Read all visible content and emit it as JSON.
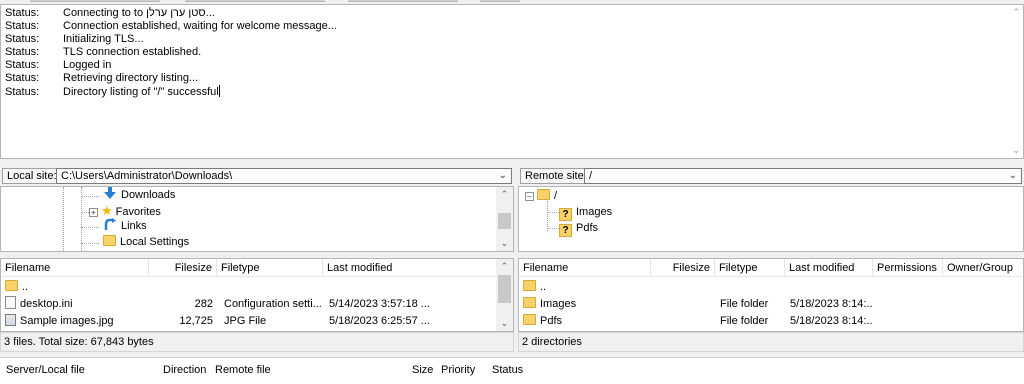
{
  "log": {
    "entries": [
      {
        "label": "Status:",
        "text": "Connecting to  to סטן ערן ערלן..."
      },
      {
        "label": "Status:",
        "text": "Connection established, waiting for welcome message..."
      },
      {
        "label": "Status:",
        "text": "Initializing TLS..."
      },
      {
        "label": "Status:",
        "text": "TLS connection established."
      },
      {
        "label": "Status:",
        "text": "Logged in"
      },
      {
        "label": "Status:",
        "text": "Retrieving directory listing..."
      },
      {
        "label": "Status:",
        "text": "Directory listing of \"/\" successful"
      }
    ]
  },
  "local": {
    "site_label": "Local site:",
    "path": "C:\\Users\\Administrator\\Downloads\\",
    "tree": [
      {
        "name": "Downloads",
        "icon": "download-arrow-icon"
      },
      {
        "name": "Favorites",
        "icon": "star-icon"
      },
      {
        "name": "Links",
        "icon": "link-arrow-icon"
      },
      {
        "name": "Local Settings",
        "icon": "folder-icon"
      }
    ],
    "columns": [
      "Filename",
      "Filesize",
      "Filetype",
      "Last modified"
    ],
    "files": [
      {
        "name": "..",
        "size": "",
        "type": "",
        "modified": "",
        "icon": "folder-icon"
      },
      {
        "name": "desktop.ini",
        "size": "282",
        "type": "Configuration setti...",
        "modified": "5/14/2023 3:57:18 ...",
        "icon": "settings-file-icon"
      },
      {
        "name": "Sample images.jpg",
        "size": "12,725",
        "type": "JPG File",
        "modified": "5/18/2023 6:25:57 ...",
        "icon": "image-file-icon"
      }
    ],
    "status": "3 files. Total size: 67,843 bytes"
  },
  "remote": {
    "site_label": "Remote site:",
    "path": "/",
    "tree": [
      {
        "name": "/",
        "icon": "folder-icon"
      },
      {
        "name": "Images",
        "icon": "unknown-folder-icon"
      },
      {
        "name": "Pdfs",
        "icon": "unknown-folder-icon"
      }
    ],
    "columns": [
      "Filename",
      "Filesize",
      "Filetype",
      "Last modified",
      "Permissions",
      "Owner/Group"
    ],
    "files": [
      {
        "name": "..",
        "type": "",
        "modified": ""
      },
      {
        "name": "Images",
        "type": "File folder",
        "modified": "5/18/2023 8:14:..."
      },
      {
        "name": "Pdfs",
        "type": "File folder",
        "modified": "5/18/2023 8:14:..."
      }
    ],
    "status": "2 directories"
  },
  "queue": {
    "columns": [
      "Server/Local file",
      "Direction",
      "Remote file",
      "Size",
      "Priority",
      "Status"
    ]
  },
  "colors": {
    "folder": "#f7d16a",
    "download_arrow": "#2a7fd4"
  }
}
